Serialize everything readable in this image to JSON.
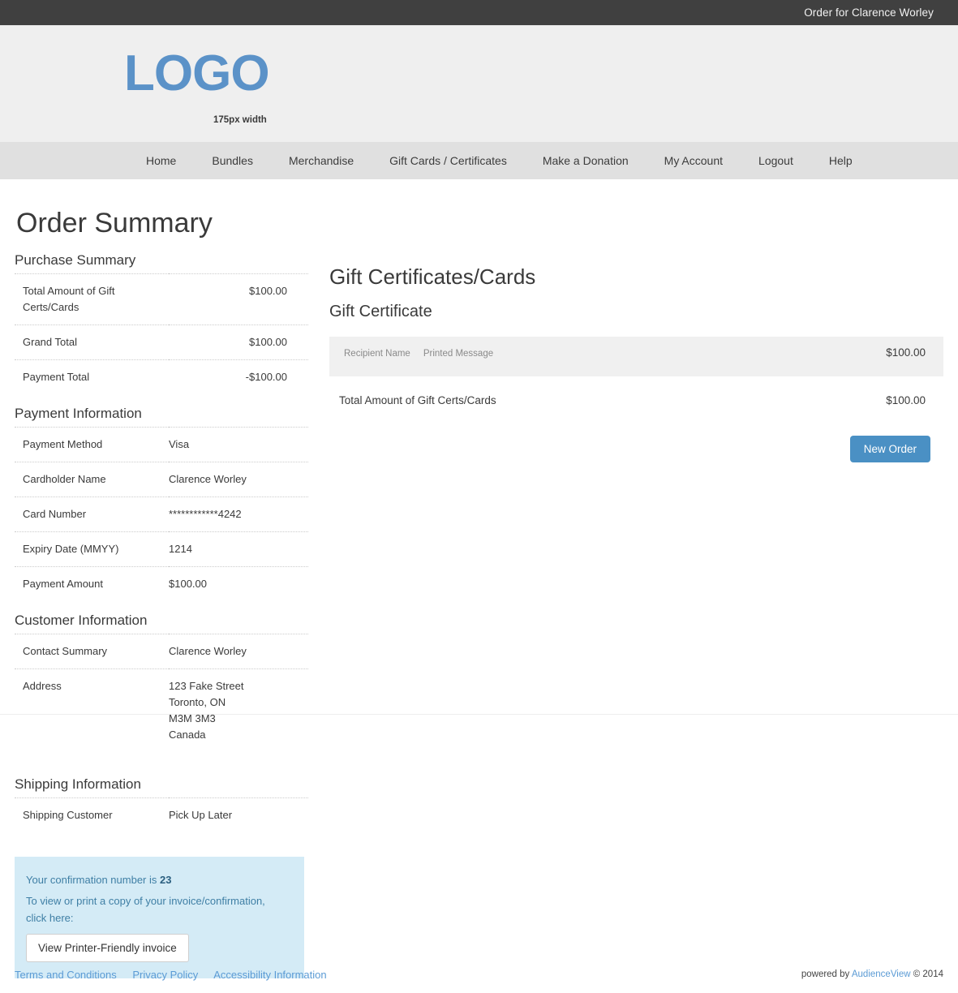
{
  "topbar": {
    "order_for": "Order for Clarence Worley"
  },
  "branding": {
    "logo_text": "LOGO",
    "logo_caption": "175px width"
  },
  "nav": {
    "items": [
      {
        "label": "Home"
      },
      {
        "label": "Bundles"
      },
      {
        "label": "Merchandise"
      },
      {
        "label": "Gift Cards / Certificates"
      },
      {
        "label": "Make a Donation"
      },
      {
        "label": "My Account"
      },
      {
        "label": "Logout"
      },
      {
        "label": "Help"
      }
    ]
  },
  "page": {
    "title": "Order Summary"
  },
  "purchase_summary": {
    "heading": "Purchase Summary",
    "rows": [
      {
        "label": "Total Amount of Gift Certs/Cards",
        "value": "$100.00"
      },
      {
        "label": "Grand Total",
        "value": "$100.00"
      },
      {
        "label": "Payment Total",
        "value": "-$100.00"
      }
    ]
  },
  "payment_information": {
    "heading": "Payment Information",
    "rows": [
      {
        "label": "Payment Method",
        "value": "Visa"
      },
      {
        "label": "Cardholder Name",
        "value": "Clarence Worley"
      },
      {
        "label": "Card Number",
        "value": "************4242"
      },
      {
        "label": "Expiry Date (MMYY)",
        "value": "1214"
      },
      {
        "label": "Payment Amount",
        "value": "$100.00"
      }
    ]
  },
  "customer_information": {
    "heading": "Customer Information",
    "contact_label": "Contact Summary",
    "contact_value": "Clarence Worley",
    "address_label": "Address",
    "address_lines": [
      "123 Fake Street",
      "Toronto, ON",
      "M3M 3M3",
      "Canada"
    ]
  },
  "shipping_information": {
    "heading": "Shipping Information",
    "rows": [
      {
        "label": "Shipping Customer",
        "value": "Pick Up Later"
      }
    ]
  },
  "confirmation": {
    "line1_prefix": "Your confirmation number is ",
    "number": "23",
    "line2": "To view or print a copy of your invoice/confirmation, click here:",
    "button_label": "View Printer-Friendly invoice",
    "background_color": "#d4ebf6",
    "text_color": "#3f7fa5"
  },
  "gift_certificates": {
    "heading": "Gift Certificates/Cards",
    "subheading": "Gift Certificate",
    "item": {
      "recipient_name_label": "Recipient Name",
      "printed_message_label": "Printed Message",
      "recipient_name_value": "",
      "printed_message_value": "",
      "amount": "$100.00"
    },
    "total_label": "Total Amount of Gift Certs/Cards",
    "total_amount": "$100.00",
    "new_order_button": "New Order",
    "accent_color": "#4a90c4"
  },
  "footer": {
    "links": [
      {
        "label": "Terms and Conditions"
      },
      {
        "label": "Privacy Policy"
      },
      {
        "label": "Accessibility Information"
      }
    ],
    "powered_by_prefix": "powered by ",
    "powered_by_brand": "AudienceView",
    "copyright": " © 2014"
  }
}
